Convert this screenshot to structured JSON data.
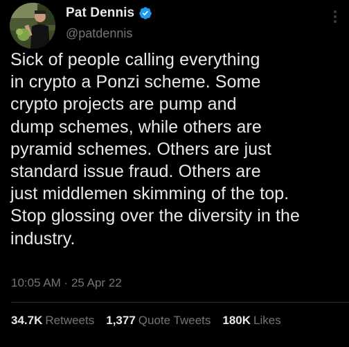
{
  "author": {
    "display_name": "Pat Dennis",
    "handle": "@patdennis",
    "verified": true
  },
  "tweet": {
    "text": "Sick of people calling everything\nin crypto a Ponzi scheme. Some\ncrypto projects are pump and\ndump schemes, while others are\npyramid schemes. Others are just\nstandard issue fraud. Others are\njust middlemen skimming of the top.\nStop glossing over the diversity in the\nindustry.",
    "time": "10:05 AM",
    "separator": " · ",
    "date": "25 Apr 22"
  },
  "stats": {
    "retweets_count": "34.7K",
    "retweets_label": "Retweets",
    "quotes_count": "1,377",
    "quotes_label": "Quote Tweets",
    "likes_count": "180K",
    "likes_label": "Likes"
  },
  "colors": {
    "background": "#000000",
    "text": "#e7e9ea",
    "secondary": "#71767b",
    "verified_blue": "#1d9bf0"
  },
  "icons": {
    "verified": "verified-badge-icon",
    "more": "more-options-icon"
  }
}
